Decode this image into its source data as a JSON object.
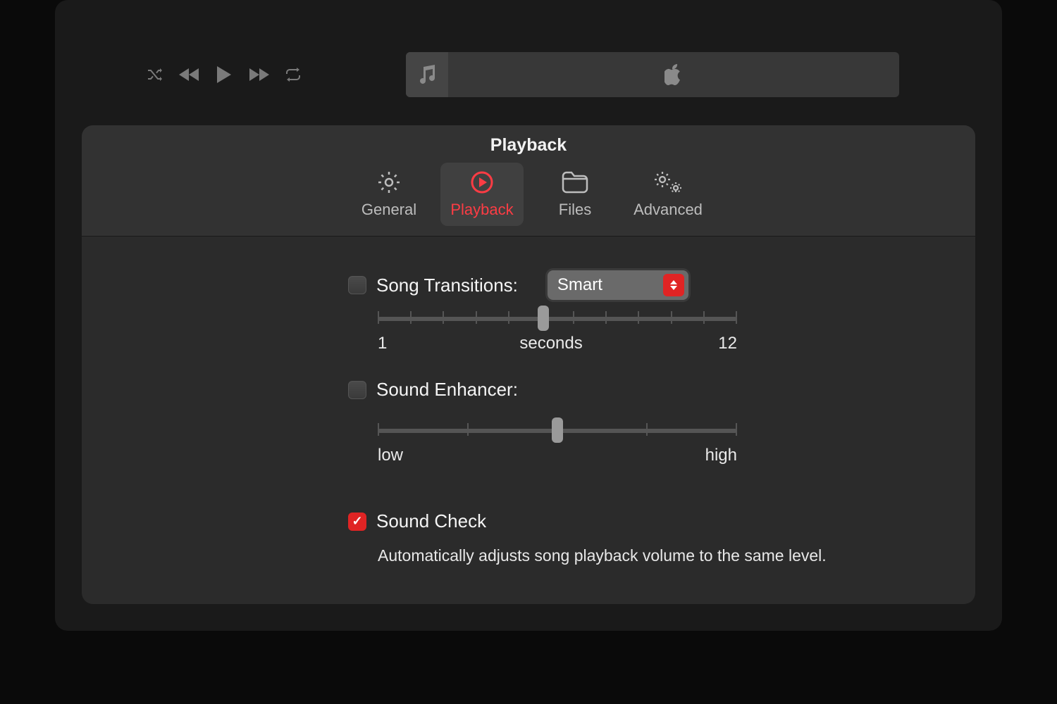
{
  "window": {
    "title": "Playback"
  },
  "tabs": {
    "general": "General",
    "playback": "Playback",
    "files": "Files",
    "advanced": "Advanced"
  },
  "transitions": {
    "label": "Song Transitions:",
    "dropdown_value": "Smart",
    "slider_min_label": "1",
    "slider_mid_label": "seconds",
    "slider_max_label": "12",
    "slider_pos_pct": 46
  },
  "enhancer": {
    "label": "Sound Enhancer:",
    "slider_low": "low",
    "slider_high": "high",
    "slider_pos_pct": 50
  },
  "soundcheck": {
    "label": "Sound Check",
    "description": "Automatically adjusts song playback volume to the same level."
  }
}
